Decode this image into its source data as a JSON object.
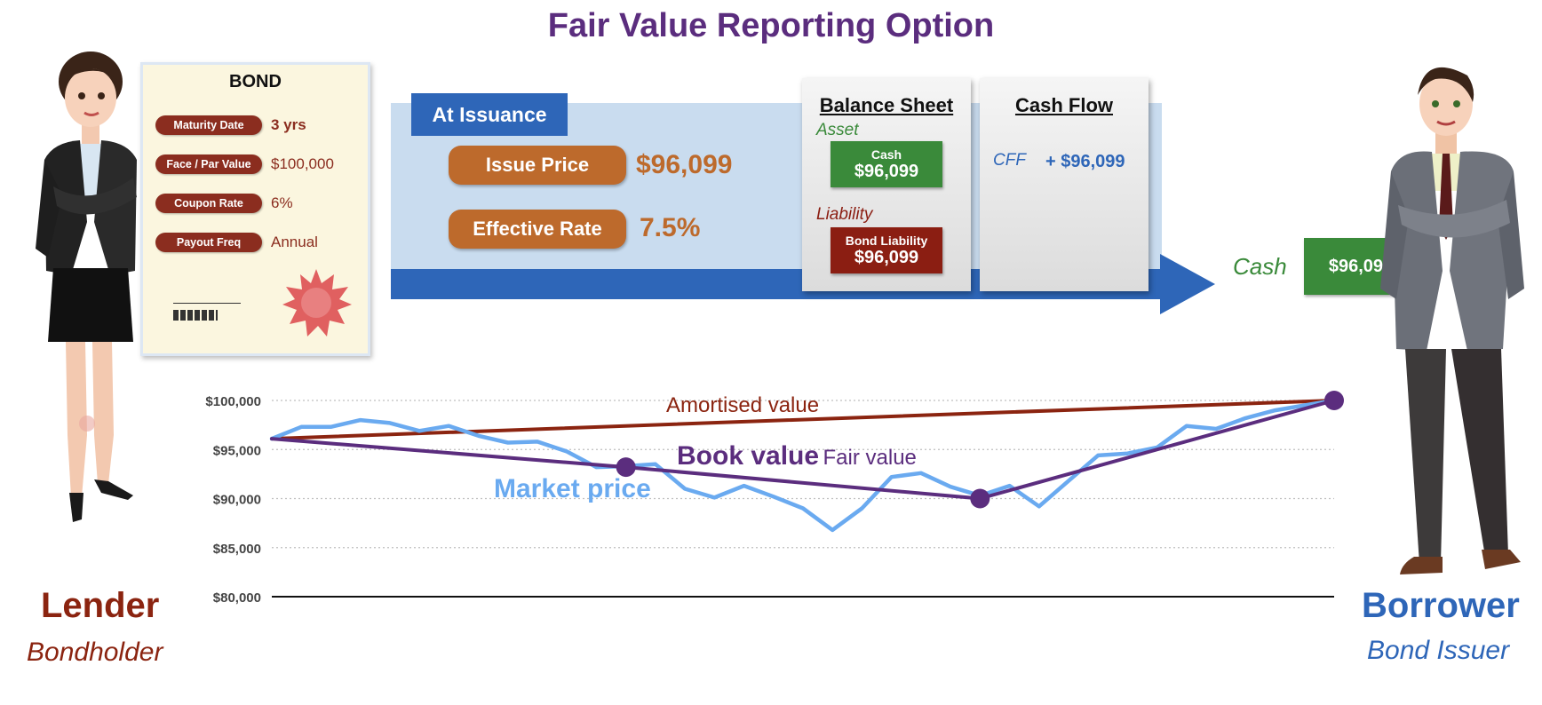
{
  "title": "Fair Value Reporting Option",
  "bond": {
    "title": "BOND",
    "rows": [
      {
        "label": "Maturity Date",
        "value": "3 yrs"
      },
      {
        "label": "Face / Par Value",
        "value": "$100,000"
      },
      {
        "label": "Coupon Rate",
        "value": "6%"
      },
      {
        "label": "Payout Freq",
        "value": "Annual"
      }
    ]
  },
  "issuance": {
    "label": "At Issuance",
    "issue_price_label": "Issue Price",
    "issue_price_value": "$96,099",
    "effective_rate_label": "Effective Rate",
    "effective_rate_value": "7.5%"
  },
  "balance_sheet": {
    "title": "Balance Sheet",
    "asset_label": "Asset",
    "cash_label": "Cash",
    "cash_value": "$96,099",
    "liability_label": "Liability",
    "bond_liability_label": "Bond Liability",
    "bond_liability_value": "$96,099"
  },
  "cash_flow": {
    "title": "Cash Flow",
    "cff_label": "CFF",
    "cff_value": "+ $96,099"
  },
  "cash_transfer": {
    "label": "Cash",
    "value": "$96,099"
  },
  "lender": {
    "name": "Lender",
    "role": "Bondholder"
  },
  "borrower": {
    "name": "Borrower",
    "role": "Bond Issuer"
  },
  "colors": {
    "title": "#5b2d7e",
    "amortised": "#8b2410",
    "book": "#5b2d7e",
    "market": "#6aaaf0",
    "cash_green": "#3a8a3a",
    "liability_red": "#8b1e12",
    "blue": "#2e66b8",
    "orange": "#bd6a2c"
  },
  "chart_data": {
    "type": "line",
    "ylim": [
      80000,
      100000
    ],
    "y_ticks": [
      "$100,000",
      "$95,000",
      "$90,000",
      "$85,000",
      "$80,000"
    ],
    "y_tick_values": [
      100000,
      95000,
      90000,
      85000,
      80000
    ],
    "x_range": [
      0,
      36
    ],
    "annotations": {
      "book_value": "Book value",
      "fair_value": "Fair value"
    },
    "series": [
      {
        "name": "Amortised value",
        "x": [
          0,
          36
        ],
        "values": [
          96099,
          100000
        ]
      },
      {
        "name": "Market price",
        "x": [
          0,
          1,
          2,
          3,
          4,
          5,
          6,
          7,
          8,
          9,
          10,
          11,
          12,
          13,
          14,
          15,
          16,
          17,
          18,
          19,
          20,
          21,
          22,
          23,
          24,
          25,
          26,
          27,
          28,
          29,
          30,
          31,
          32,
          33,
          34,
          35,
          36
        ],
        "values": [
          96100,
          97300,
          97300,
          98000,
          97700,
          96900,
          97400,
          96400,
          95700,
          95800,
          94800,
          93200,
          93300,
          93500,
          91000,
          90100,
          91300,
          90200,
          89000,
          86800,
          89000,
          92200,
          92600,
          91200,
          90300,
          91300,
          89200,
          91800,
          94400,
          94600,
          95200,
          97400,
          97100,
          98200,
          99000,
          99500,
          100000
        ]
      },
      {
        "name": "Book value",
        "x": [
          0,
          12,
          24,
          36
        ],
        "values": [
          96099,
          93200,
          90000,
          100000
        ]
      }
    ],
    "markers": [
      {
        "x": 12,
        "value": 93200
      },
      {
        "x": 24,
        "value": 90000
      },
      {
        "x": 36,
        "value": 100000
      }
    ]
  }
}
